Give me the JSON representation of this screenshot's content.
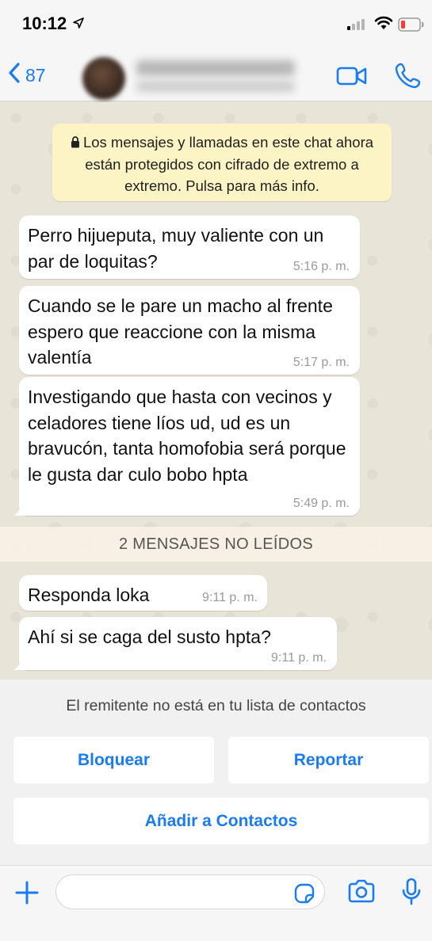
{
  "status_bar": {
    "time": "10:12"
  },
  "header": {
    "back_count": "87",
    "contact_name": "",
    "contact_subtitle": ""
  },
  "chat": {
    "encryption_notice": "Los mensajes y llamadas en este chat ahora están protegidos con cifrado de extremo a extremo. Pulsa para más info.",
    "unread_label": "2 MENSAJES NO LEÍDOS",
    "messages": [
      {
        "text": "Perro hijueputa, muy valiente con un par de loquitas?",
        "time": "5:16 p. m."
      },
      {
        "text": "Cuando se le pare un macho al frente espero que reaccione con la misma valentía",
        "time": "5:17 p. m."
      },
      {
        "text": "Investigando que hasta con vecinos y celadores tiene líos ud, ud es un bravucón, tanta homofobia será porque le gusta dar culo bobo hpta",
        "time": "5:49 p. m."
      },
      {
        "text": "Responda loka",
        "time": "9:11 p. m."
      },
      {
        "text": "Ahí si se caga del susto hpta?",
        "time": "9:11 p. m."
      }
    ]
  },
  "unknown_sender": {
    "note": "El remitente no está en tu lista de contactos",
    "block_label": "Bloquear",
    "report_label": "Reportar",
    "add_contact_label": "Añadir a Contactos"
  },
  "colors": {
    "accent": "#1a7bf2",
    "chat_background": "#e9e4d8",
    "notice_background": "#fdf4c5",
    "bubble_background": "#ffffff"
  },
  "icons": {
    "location": "location-arrow-icon",
    "signal": "cellular-signal-icon",
    "wifi": "wifi-icon",
    "battery": "battery-low-icon",
    "back": "chevron-left-icon",
    "video": "video-camera-icon",
    "call": "phone-icon",
    "lock": "lock-icon",
    "plus": "plus-icon",
    "sticker": "sticker-icon",
    "camera": "camera-icon",
    "mic": "microphone-icon"
  }
}
